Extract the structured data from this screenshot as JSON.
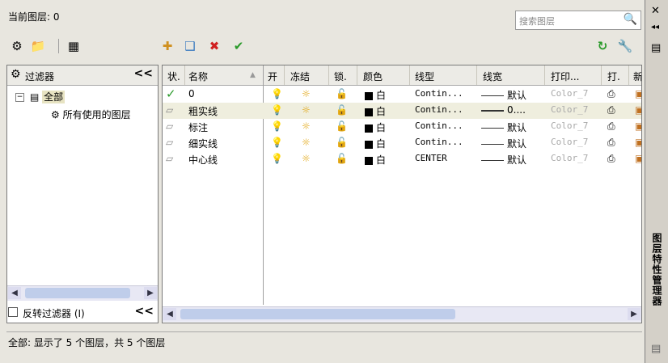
{
  "header": {
    "current_layer": "当前图层: 0"
  },
  "search": {
    "placeholder": "搜索图层"
  },
  "toolbar": {
    "left_icons": [
      "new-property-filter",
      "new-group-filter",
      "layer-state-manager"
    ],
    "mid_icons": [
      "new-layer",
      "new-layer-vp-frozen",
      "delete-layer",
      "set-current"
    ],
    "right_icons": [
      "refresh",
      "settings"
    ]
  },
  "filter_panel": {
    "title": "过滤器",
    "collapse": "<<",
    "tree": [
      {
        "label": "全部",
        "expanded": true
      },
      {
        "label": "所有使用的图层"
      }
    ],
    "invert_label": "反转过滤器 (I)",
    "invert_collapse": "<<"
  },
  "grid": {
    "columns": [
      "状.",
      "名称",
      "开",
      "冻结",
      "锁.",
      "颜色",
      "线型",
      "线宽",
      "打印...",
      "打.",
      "新"
    ],
    "rows": [
      {
        "status": "✓",
        "name": "0",
        "color": "白",
        "linetype": "Contin...",
        "lineweight": "默认",
        "plotstyle": "Color_7"
      },
      {
        "status": "",
        "name": "粗实线",
        "color": "白",
        "linetype": "Contin...",
        "lineweight": "0....",
        "plotstyle": "Color_7",
        "selected": true
      },
      {
        "status": "",
        "name": "标注",
        "color": "白",
        "linetype": "Contin...",
        "lineweight": "默认",
        "plotstyle": "Color_7"
      },
      {
        "status": "",
        "name": "细实线",
        "color": "白",
        "linetype": "Contin...",
        "lineweight": "默认",
        "plotstyle": "Color_7"
      },
      {
        "status": "",
        "name": "中心线",
        "color": "白",
        "linetype": "CENTER",
        "lineweight": "默认",
        "plotstyle": "Color_7"
      }
    ]
  },
  "status_bar": {
    "text": "全部: 显示了 5 个图层，共 5 个图层"
  },
  "side": {
    "title": "图层特性管理器",
    "close": "✕",
    "autohide": "◂◂",
    "props": "▤"
  },
  "colors": {
    "accent": "#2a9a2a",
    "delete": "#d02020",
    "selection": "#efeede"
  }
}
